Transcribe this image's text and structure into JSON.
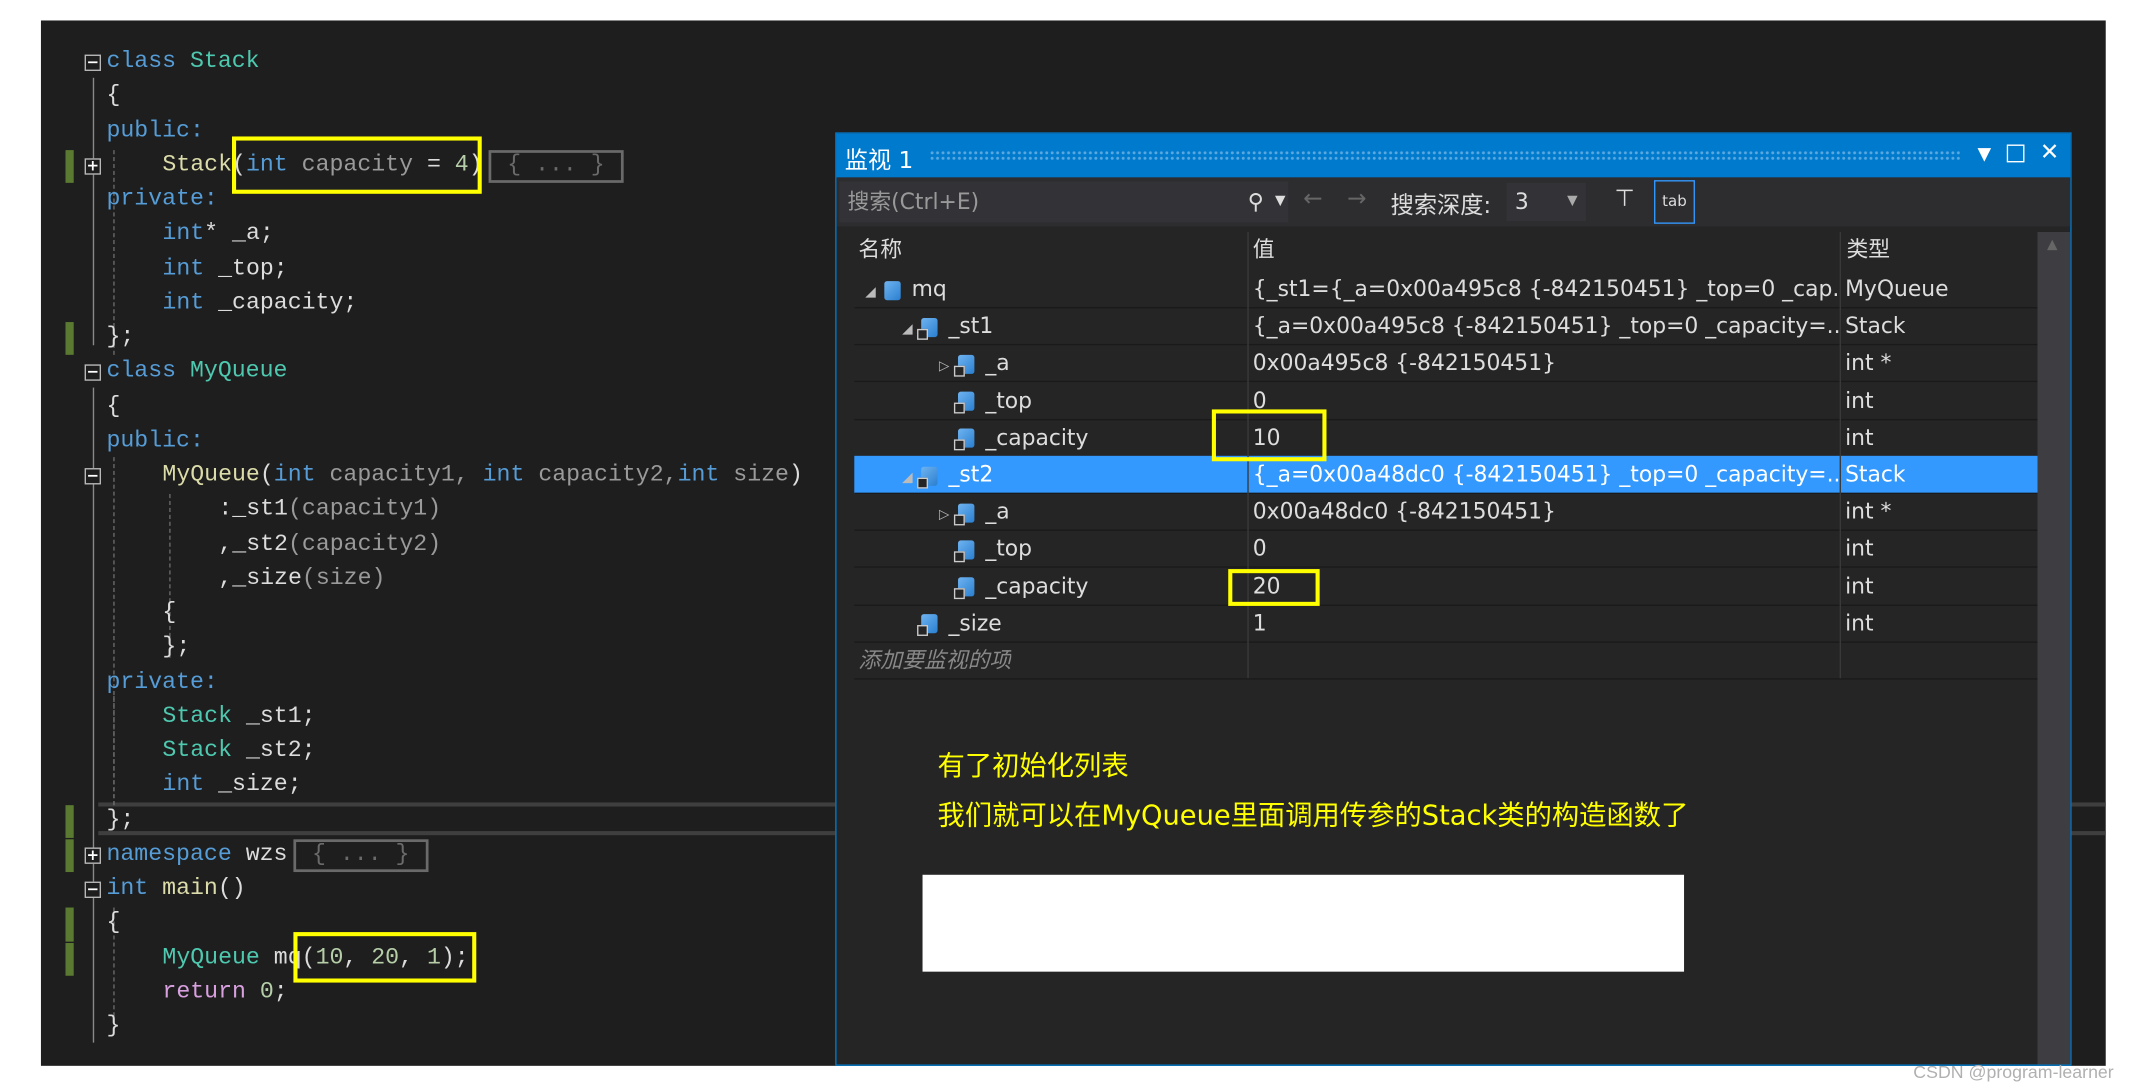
{
  "editor": {
    "lines": [
      {
        "indent": 0,
        "fold": "minus",
        "tokens": [
          {
            "t": "class ",
            "c": "kw"
          },
          {
            "t": "Stack",
            "c": "ty"
          }
        ]
      },
      {
        "indent": 0,
        "tokens": [
          {
            "t": "{",
            "c": "pl"
          }
        ]
      },
      {
        "indent": 0,
        "tokens": [
          {
            "t": "public:",
            "c": "kw"
          }
        ]
      },
      {
        "indent": 1,
        "fold": "plus",
        "green": true,
        "tokens": [
          {
            "t": "Stack",
            "c": "fn"
          },
          {
            "t": "(",
            "c": "pl"
          },
          {
            "t": "int ",
            "c": "kw"
          },
          {
            "t": "capacity",
            "c": "pa"
          },
          {
            "t": " = ",
            "c": "pl"
          },
          {
            "t": "4",
            "c": "nu"
          },
          {
            "t": ")",
            "c": "pl"
          }
        ],
        "collapsed": "{ ... }"
      },
      {
        "indent": 0,
        "tokens": [
          {
            "t": "private:",
            "c": "kw"
          }
        ]
      },
      {
        "indent": 1,
        "tokens": [
          {
            "t": "int",
            "c": "kw"
          },
          {
            "t": "* _a;",
            "c": "pl"
          }
        ]
      },
      {
        "indent": 1,
        "tokens": [
          {
            "t": "int ",
            "c": "kw"
          },
          {
            "t": "_top;",
            "c": "pl"
          }
        ]
      },
      {
        "indent": 1,
        "tokens": [
          {
            "t": "int ",
            "c": "kw"
          },
          {
            "t": "_capacity;",
            "c": "pl"
          }
        ]
      },
      {
        "indent": 0,
        "green": true,
        "tokens": [
          {
            "t": "};",
            "c": "pl"
          }
        ]
      },
      {
        "indent": 0,
        "fold": "minus",
        "tokens": [
          {
            "t": "class ",
            "c": "kw"
          },
          {
            "t": "MyQueue",
            "c": "ty"
          }
        ]
      },
      {
        "indent": 0,
        "tokens": [
          {
            "t": "{",
            "c": "pl"
          }
        ]
      },
      {
        "indent": 0,
        "tokens": [
          {
            "t": "public:",
            "c": "kw"
          }
        ]
      },
      {
        "indent": 1,
        "fold": "minus",
        "tokens": [
          {
            "t": "MyQueue",
            "c": "fn"
          },
          {
            "t": "(",
            "c": "pl"
          },
          {
            "t": "int ",
            "c": "kw"
          },
          {
            "t": "capacity1, ",
            "c": "pa"
          },
          {
            "t": "int ",
            "c": "kw"
          },
          {
            "t": "capacity2,",
            "c": "pa"
          },
          {
            "t": "int ",
            "c": "kw"
          },
          {
            "t": "size",
            "c": "pa"
          },
          {
            "t": ")",
            "c": "pl"
          }
        ]
      },
      {
        "indent": 2,
        "tokens": [
          {
            "t": ":_st1",
            "c": "pl"
          },
          {
            "t": "(capacity1)",
            "c": "pa"
          }
        ]
      },
      {
        "indent": 2,
        "tokens": [
          {
            "t": ",_st2",
            "c": "pl"
          },
          {
            "t": "(capacity2)",
            "c": "pa"
          }
        ]
      },
      {
        "indent": 2,
        "tokens": [
          {
            "t": ",_size",
            "c": "pl"
          },
          {
            "t": "(size)",
            "c": "pa"
          }
        ]
      },
      {
        "indent": 1,
        "tokens": [
          {
            "t": "{",
            "c": "pl"
          }
        ]
      },
      {
        "indent": 1,
        "tokens": [
          {
            "t": "};",
            "c": "pl"
          }
        ]
      },
      {
        "indent": 0,
        "tokens": [
          {
            "t": "private:",
            "c": "kw"
          }
        ]
      },
      {
        "indent": 1,
        "tokens": [
          {
            "t": "Stack ",
            "c": "ty"
          },
          {
            "t": "_st1;",
            "c": "pl"
          }
        ]
      },
      {
        "indent": 1,
        "tokens": [
          {
            "t": "Stack ",
            "c": "ty"
          },
          {
            "t": "_st2;",
            "c": "pl"
          }
        ]
      },
      {
        "indent": 1,
        "tokens": [
          {
            "t": "int ",
            "c": "kw"
          },
          {
            "t": "_size;",
            "c": "pl"
          }
        ]
      },
      {
        "indent": 0,
        "green": true,
        "tokens": [
          {
            "t": "};",
            "c": "pl"
          }
        ]
      },
      {
        "indent": 0,
        "fold": "plus",
        "green": true,
        "tokens": [
          {
            "t": "namespace ",
            "c": "kw"
          },
          {
            "t": "wzs",
            "c": "pl"
          }
        ],
        "collapsed": "{ ... }"
      },
      {
        "indent": 0,
        "fold": "minus",
        "tokens": [
          {
            "t": "int ",
            "c": "kw"
          },
          {
            "t": "main",
            "c": "fn"
          },
          {
            "t": "()",
            "c": "pl"
          }
        ]
      },
      {
        "indent": 0,
        "green": true,
        "tokens": [
          {
            "t": "{",
            "c": "pl"
          }
        ]
      },
      {
        "indent": 1,
        "green": true,
        "tokens": [
          {
            "t": "MyQueue ",
            "c": "ty"
          },
          {
            "t": "mq",
            "c": "pl"
          },
          {
            "t": "(",
            "c": "pl"
          },
          {
            "t": "10",
            "c": "nu"
          },
          {
            "t": ", ",
            "c": "pl"
          },
          {
            "t": "20",
            "c": "nu"
          },
          {
            "t": ", ",
            "c": "pl"
          },
          {
            "t": "1",
            "c": "nu"
          },
          {
            "t": ");",
            "c": "pl"
          }
        ]
      },
      {
        "indent": 1,
        "tokens": [
          {
            "t": "return ",
            "c": "rt"
          },
          {
            "t": "0",
            "c": "nu"
          },
          {
            "t": ";",
            "c": "pl"
          }
        ]
      },
      {
        "indent": 0,
        "tokens": [
          {
            "t": "}",
            "c": "pl"
          }
        ]
      }
    ]
  },
  "watch": {
    "title": "监视 1",
    "search_placeholder": "搜索(Ctrl+E)",
    "depth_label": "搜索深度:",
    "depth_value": "3",
    "columns": [
      "名称",
      "值",
      "类型"
    ],
    "rows": [
      {
        "level": 0,
        "expander": "expanded",
        "icon": "object",
        "name": "mq",
        "value": "{_st1={_a=0x00a495c8 {-842150451} _top=0 _cap...",
        "type": "MyQueue"
      },
      {
        "level": 1,
        "expander": "expanded",
        "icon": "private-field",
        "name": "_st1",
        "value": "{_a=0x00a495c8 {-842150451} _top=0 _capacity=...",
        "type": "Stack"
      },
      {
        "level": 2,
        "expander": "collapsed",
        "icon": "private-field",
        "name": "_a",
        "value": "0x00a495c8 {-842150451}",
        "type": "int *"
      },
      {
        "level": 2,
        "icon": "private-field",
        "name": "_top",
        "value": "0",
        "type": "int"
      },
      {
        "level": 2,
        "icon": "private-field",
        "name": "_capacity",
        "value": "10",
        "type": "int"
      },
      {
        "level": 1,
        "expander": "expanded",
        "icon": "private-field",
        "name": "_st2",
        "value": "{_a=0x00a48dc0 {-842150451} _top=0 _capacity=...",
        "type": "Stack",
        "selected": true
      },
      {
        "level": 2,
        "expander": "collapsed",
        "icon": "private-field",
        "name": "_a",
        "value": "0x00a48dc0 {-842150451}",
        "type": "int *"
      },
      {
        "level": 2,
        "icon": "private-field",
        "name": "_top",
        "value": "0",
        "type": "int"
      },
      {
        "level": 2,
        "icon": "private-field",
        "name": "_capacity",
        "value": "20",
        "type": "int"
      },
      {
        "level": 1,
        "icon": "private-field",
        "name": "_size",
        "value": "1",
        "type": "int"
      }
    ],
    "add_item_placeholder": "添加要监视的项"
  },
  "annotation": {
    "line1": "有了初始化列表",
    "line2": "我们就可以在MyQueue里面调用传参的Stack类的构造函数了"
  },
  "highlight_color": "#ffff00",
  "selection_color": "#3399ff",
  "watermark": "CSDN @program-learner"
}
